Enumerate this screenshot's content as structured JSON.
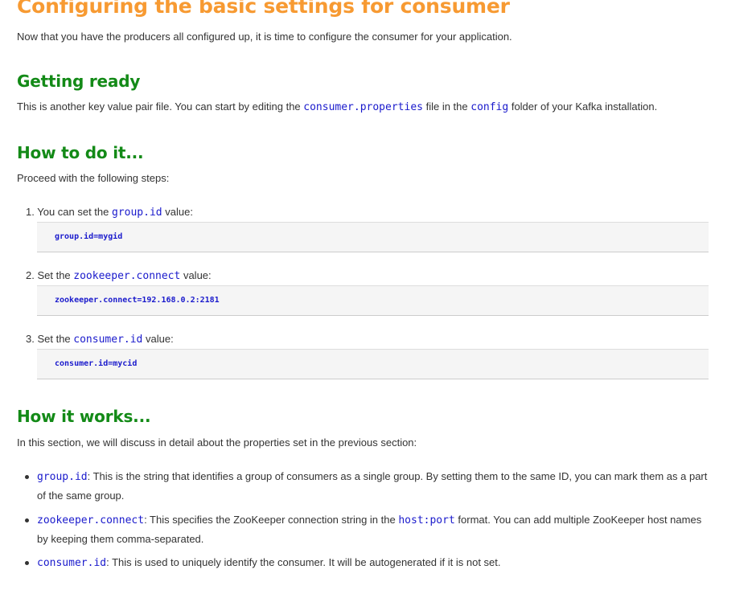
{
  "title": "Configuring the basic settings for consumer",
  "intro": "Now that you have the producers all configured up, it is time to configure the consumer for your application.",
  "getting_ready": {
    "heading": "Getting ready",
    "text_before": "This is another key value pair file. You can start by editing the ",
    "code1": "consumer.properties",
    "text_mid": " file in the ",
    "code2": "config",
    "text_after": " folder of your Kafka installation."
  },
  "how_to": {
    "heading": "How to do it...",
    "lead": "Proceed with the following steps:",
    "steps": [
      {
        "num": "1.",
        "before": "You can set the ",
        "code": "group.id",
        "after": " value:",
        "snippet": "group.id=mygid"
      },
      {
        "num": "2.",
        "before": "Set the ",
        "code": "zookeeper.connect",
        "after": " value:",
        "snippet": "zookeeper.connect=192.168.0.2:2181"
      },
      {
        "num": "3.",
        "before": "Set the ",
        "code": "consumer.id",
        "after": " value:",
        "snippet": "consumer.id=mycid"
      }
    ]
  },
  "how_works": {
    "heading": "How it works...",
    "lead": "In this section, we will discuss in detail about the properties set in the previous section:",
    "bullets": [
      {
        "code": "group.id",
        "text": ": This is the string that identifies a group of consumers as a single group. By setting them to the same ID, you can mark them as a part of the same group."
      },
      {
        "code": "zookeeper.connect",
        "text": ": This specifies the ZooKeeper connection string in the ",
        "code2": "host:port",
        "text2": " format. You can add multiple ZooKeeper host names by keeping them comma-separated."
      },
      {
        "code": "consumer.id",
        "text": ": This is used to uniquely identify the consumer. It will be autogenerated if it is not set."
      }
    ]
  },
  "colors": {
    "title": "#f79a32",
    "heading": "#138a17",
    "code": "#1a1acc",
    "codebox_bg": "#f5f5f5"
  }
}
